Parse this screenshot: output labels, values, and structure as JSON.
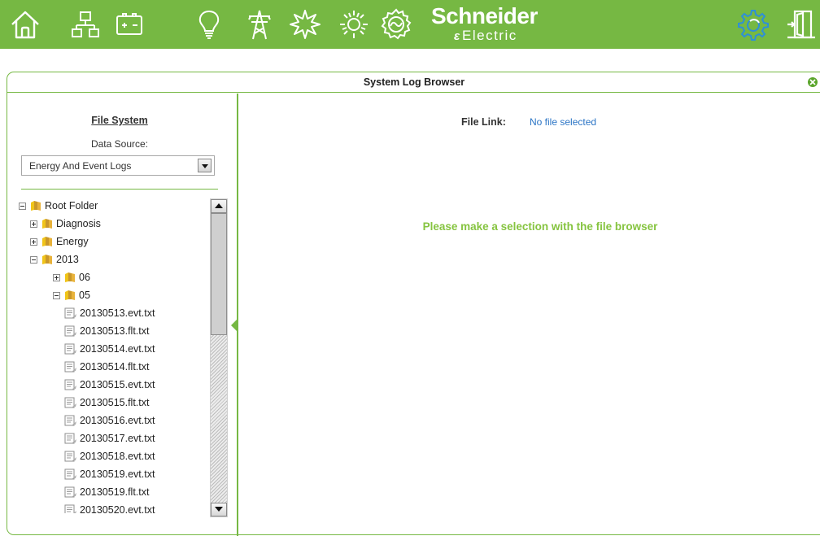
{
  "colors": {
    "accent": "#76b843",
    "link": "#2a74c5",
    "prompt": "#86c440"
  },
  "nav": {
    "icons": [
      "home-icon",
      "network-icon",
      "battery-icon",
      "lightbulb-icon",
      "tower-icon",
      "burst-icon",
      "sun-icon",
      "meter-icon",
      "settings-gear-icon",
      "logout-door-icon"
    ]
  },
  "brand": {
    "line1": "Schneider",
    "line2": "Electric",
    "mark": "ɛ"
  },
  "panel": {
    "title": "System Log Browser"
  },
  "left": {
    "file_system_title": "File System",
    "data_source_label": "Data Source:",
    "data_source_value": "Energy And Event Logs"
  },
  "tree": {
    "root": "Root Folder",
    "diagnosis": "Diagnosis",
    "energy": "Energy",
    "year": "2013",
    "month06": "06",
    "month05": "05",
    "files": [
      "20130513.evt.txt",
      "20130513.flt.txt",
      "20130514.evt.txt",
      "20130514.flt.txt",
      "20130515.evt.txt",
      "20130515.flt.txt",
      "20130516.evt.txt",
      "20130517.evt.txt",
      "20130518.evt.txt",
      "20130519.evt.txt",
      "20130519.flt.txt",
      "20130520.evt.txt"
    ]
  },
  "right": {
    "file_link_label": "File Link:",
    "file_link_value": "No file selected",
    "prompt": "Please make a selection with the file browser"
  }
}
